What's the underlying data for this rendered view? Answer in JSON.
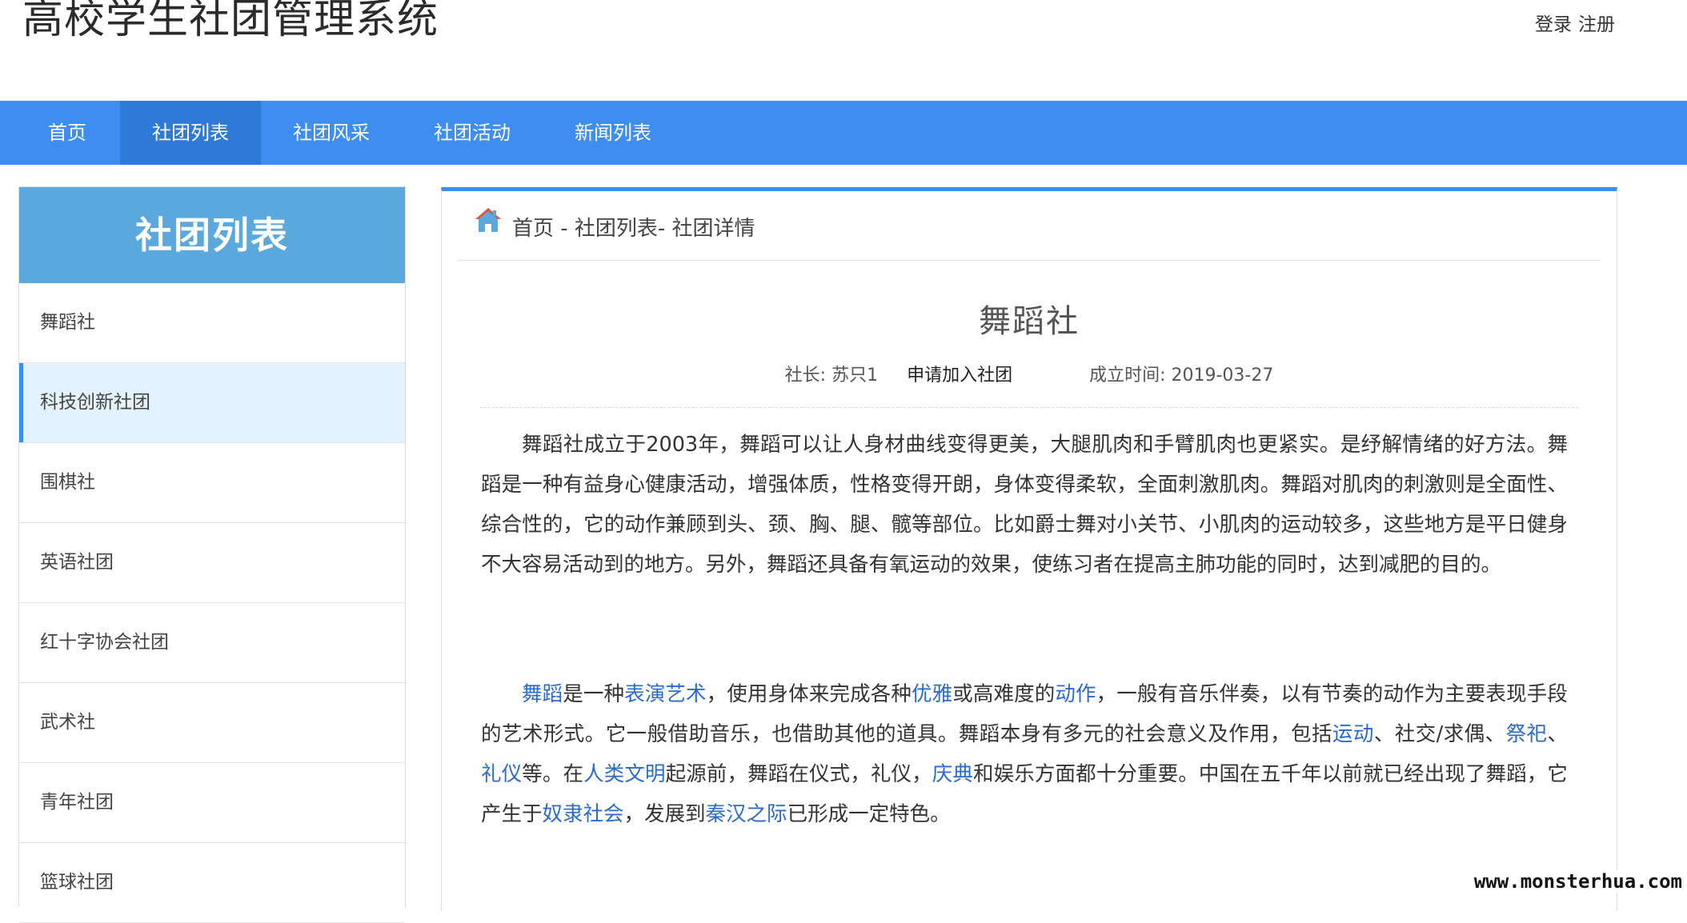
{
  "header": {
    "site_title": "高校学生社团管理系统",
    "login": "登录",
    "register": "注册"
  },
  "nav": {
    "items": [
      {
        "label": "首页"
      },
      {
        "label": "社团列表",
        "active": true
      },
      {
        "label": "社团风采"
      },
      {
        "label": "社团活动"
      },
      {
        "label": "新闻列表"
      }
    ]
  },
  "sidebar": {
    "title": "社团列表",
    "items": [
      {
        "label": "舞蹈社"
      },
      {
        "label": "科技创新社团",
        "active": true
      },
      {
        "label": "围棋社"
      },
      {
        "label": "英语社团"
      },
      {
        "label": "红十字协会社团"
      },
      {
        "label": "武术社"
      },
      {
        "label": "青年社团"
      },
      {
        "label": "篮球社团"
      }
    ]
  },
  "main": {
    "breadcrumb": "首页 - 社团列表- 社团详情",
    "club_name": "舞蹈社",
    "president_label": "社长:",
    "president_name": "苏只1",
    "join_label": "申请加入社团",
    "founded_label": "成立时间:",
    "founded_date": "2019-03-27",
    "paragraph1": "舞蹈社成立于2003年，舞蹈可以让人身材曲线变得更美，大腿肌肉和手臂肌肉也更紧实。是纾解情绪的好方法。舞蹈是一种有益身心健康活动，增强体质，性格变得开朗，身体变得柔软，全面刺激肌肉。舞蹈对肌肉的刺激则是全面性、综合性的，它的动作兼顾到头、颈、胸、腿、髋等部位。比如爵士舞对小关节、小肌肉的运动较多，这些地方是平日健身不大容易活动到的地方。另外，舞蹈还具备有氧运动的效果，使练习者在提高主肺功能的同时，达到减肥的目的。",
    "paragraph2": [
      {
        "text": "舞蹈",
        "link": true
      },
      {
        "text": "是一种",
        "link": false
      },
      {
        "text": "表演艺术",
        "link": true
      },
      {
        "text": "，使用身体来完成各种",
        "link": false
      },
      {
        "text": "优雅",
        "link": true
      },
      {
        "text": "或高难度的",
        "link": false
      },
      {
        "text": "动作",
        "link": true
      },
      {
        "text": "，一般有音乐伴奏，以有节奏的动作为主要表现手段的艺术形式。它一般借助音乐，也借助其他的道具。舞蹈本身有多元的社会意义及作用，包括",
        "link": false
      },
      {
        "text": "运动",
        "link": true
      },
      {
        "text": "、社交/求偶、",
        "link": false
      },
      {
        "text": "祭祀",
        "link": true
      },
      {
        "text": "、",
        "link": false
      },
      {
        "text": "礼仪",
        "link": true
      },
      {
        "text": "等。在",
        "link": false
      },
      {
        "text": "人类文明",
        "link": true
      },
      {
        "text": "起源前，舞蹈在仪式，礼仪，",
        "link": false
      },
      {
        "text": "庆典",
        "link": true
      },
      {
        "text": "和娱乐方面都十分重要。中国在五千年以前就已经出现了舞蹈，它产生于",
        "link": false
      },
      {
        "text": "奴隶社会",
        "link": true
      },
      {
        "text": "，发展到",
        "link": false
      },
      {
        "text": "秦汉之际",
        "link": true
      },
      {
        "text": "已形成一定特色。",
        "link": false
      }
    ]
  },
  "watermark": "www.monsterhua.com",
  "colors": {
    "nav_bg": "#3d8ef0",
    "nav_active": "#2e7ad9",
    "sidebar_title_bg": "#5aa8dd",
    "sidebar_active_bg": "#e3f2fd",
    "link": "#2a6bd1"
  }
}
